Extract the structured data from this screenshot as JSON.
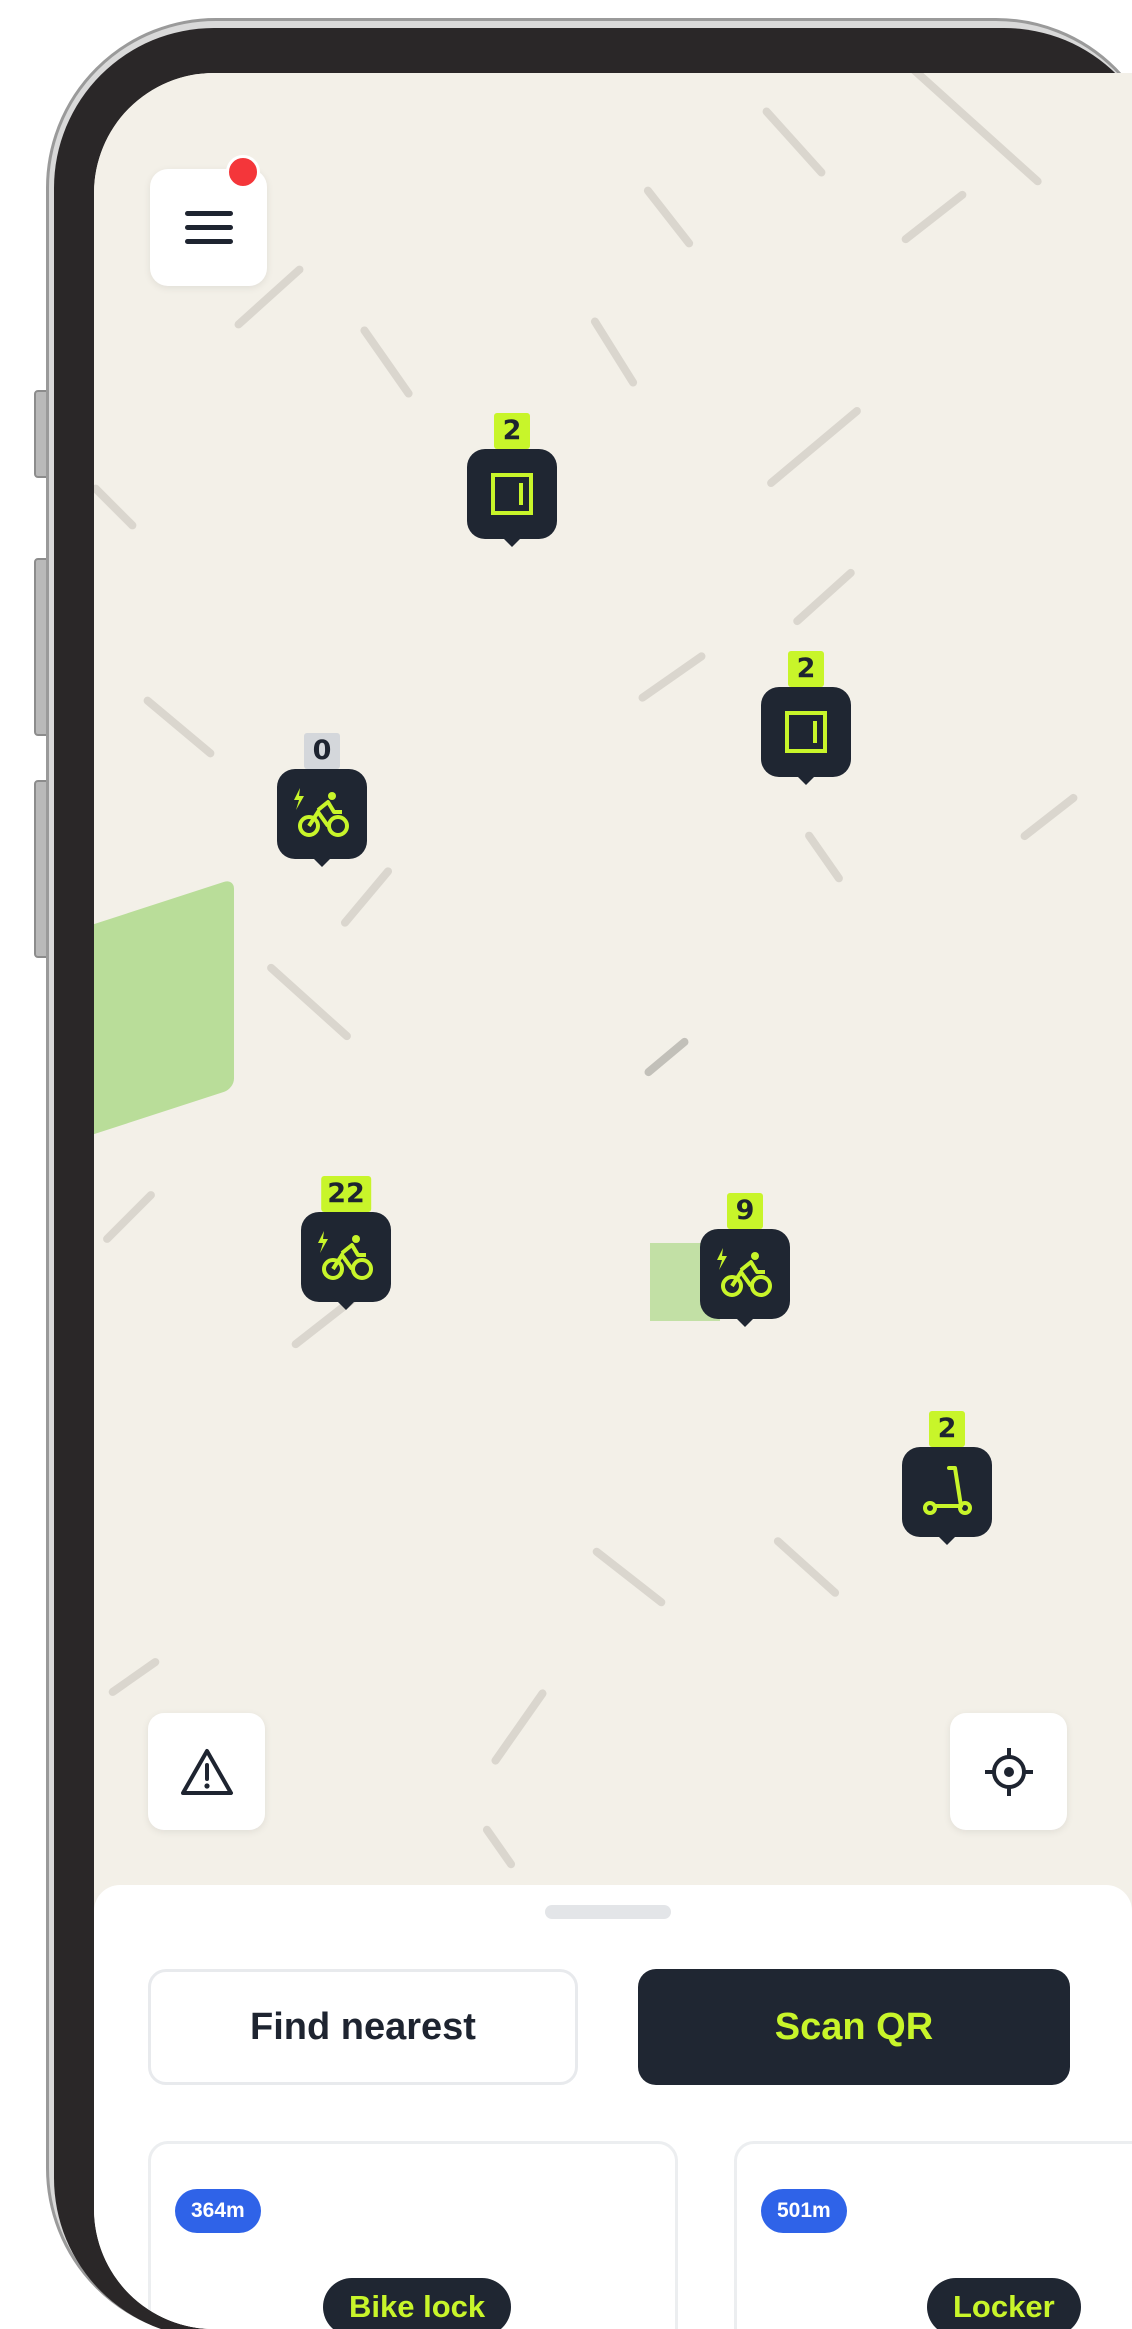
{
  "markers": [
    {
      "id": "locker-a",
      "type": "locker",
      "count": "2",
      "icon": "locker-icon"
    },
    {
      "id": "locker-b",
      "type": "locker",
      "count": "2",
      "icon": "locker-icon"
    },
    {
      "id": "ebike-a",
      "type": "e-bike",
      "count": "0",
      "icon": "e-bike-icon"
    },
    {
      "id": "ebike-b",
      "type": "e-bike",
      "count": "22",
      "icon": "e-bike-icon"
    },
    {
      "id": "ebike-c",
      "type": "e-bike",
      "count": "9",
      "icon": "e-bike-icon"
    },
    {
      "id": "scooter-a",
      "type": "scooter",
      "count": "2",
      "icon": "scooter-icon"
    }
  ],
  "actions": {
    "find_nearest": "Find nearest",
    "scan_qr": "Scan QR"
  },
  "cards": [
    {
      "distance": "364m",
      "type": "Bike lock"
    },
    {
      "distance": "501m",
      "type": "Locker"
    }
  ],
  "icons": {
    "menu": "menu-icon",
    "notification": "notification-dot",
    "report": "warning-icon",
    "locate": "crosshair-icon"
  },
  "colors": {
    "accent": "#c8f52a",
    "dark": "#1f2632",
    "distance_badge": "#2f63e8",
    "notification": "#f4363a",
    "park": "#b9dd99"
  }
}
